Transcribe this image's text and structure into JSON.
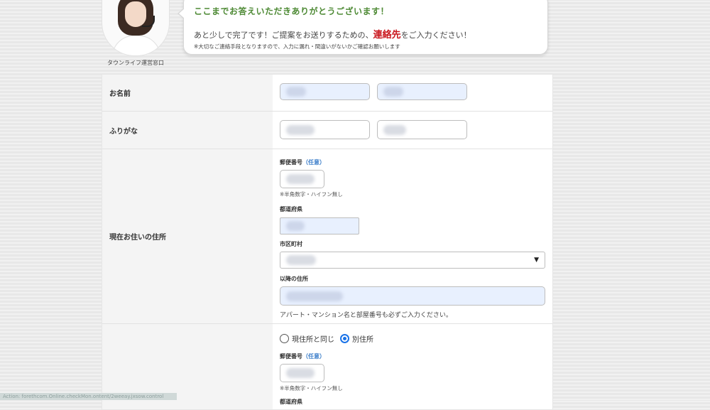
{
  "operator": {
    "caption": "タウンライフ運営窓口"
  },
  "bubble": {
    "headline": "ここまでお答えいただきありがとうございます！",
    "line2_pre": "あと少しで完了です！ご提案をお送りするための、",
    "line2_emph": "連絡先",
    "line2_post": "をご入力ください！",
    "note": "※大切なご連絡手段となりますので、入力に漏れ・間違いがないかご確認お願いします"
  },
  "form": {
    "name": {
      "label": "お名前"
    },
    "furigana": {
      "label": "ふりがな"
    },
    "address": {
      "label": "現在お住いの住所",
      "postal_label": "郵便番号",
      "optional_tag": "（任意）",
      "postal_hint": "※半角数字・ハイフン無し",
      "prefecture_label": "都道府県",
      "city_label": "市区町村",
      "street_label": "以降の住所",
      "street_notice": "アパート・マンション名と部屋番号も必ずご入力ください。"
    },
    "delivery": {
      "radio_same": "現住所と同じ",
      "radio_other": "別住所",
      "selected": "別住所",
      "postal_label": "郵便番号",
      "optional_tag": "（任意）",
      "postal_hint": "※半角数字・ハイフン無し",
      "prefecture_label": "都道府県"
    }
  },
  "statusbar": {
    "text": "Action: forethcom.Online.checkMon.ontent/2weeay.jxsow.control"
  },
  "colors": {
    "headline": "#4e8a35",
    "emphasis": "#c9161d",
    "optional": "#3a7dc9",
    "autofill": "#e8f0fe"
  }
}
